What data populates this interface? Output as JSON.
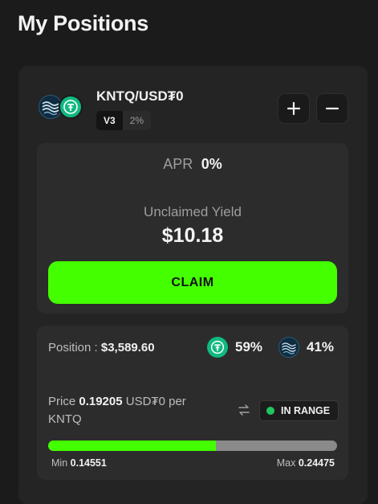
{
  "page": {
    "title": "My Positions"
  },
  "position": {
    "pair": "KNTQ/USD₮0",
    "version": "V3",
    "fee": "2%",
    "apr_label": "APR",
    "apr_value": "0%",
    "unclaimed_label": "Unclaimed Yield",
    "unclaimed_value": "$10.18",
    "claim_label": "CLAIM",
    "position_label": "Position :",
    "position_value": "$3,589.60",
    "usd_share": "59%",
    "kntq_share": "41%",
    "price_label": "Price",
    "price_value": "0.19205",
    "price_quote": "USD₮0 per",
    "price_base": "KNTQ",
    "range_status": "IN RANGE",
    "range_fill_fraction": 0.58,
    "min_label": "Min",
    "min_value": "0.14551",
    "max_label": "Max",
    "max_value": "0.24475"
  },
  "icons": {
    "kntq": "kntq-token-icon",
    "usd": "usdt0-token-icon",
    "plus": "plus-icon",
    "minus": "minus-icon",
    "swap": "swap-arrows-icon"
  },
  "colors": {
    "accent": "#44ff00",
    "usd_token": "#10b981",
    "in_range": "#22c55e"
  }
}
